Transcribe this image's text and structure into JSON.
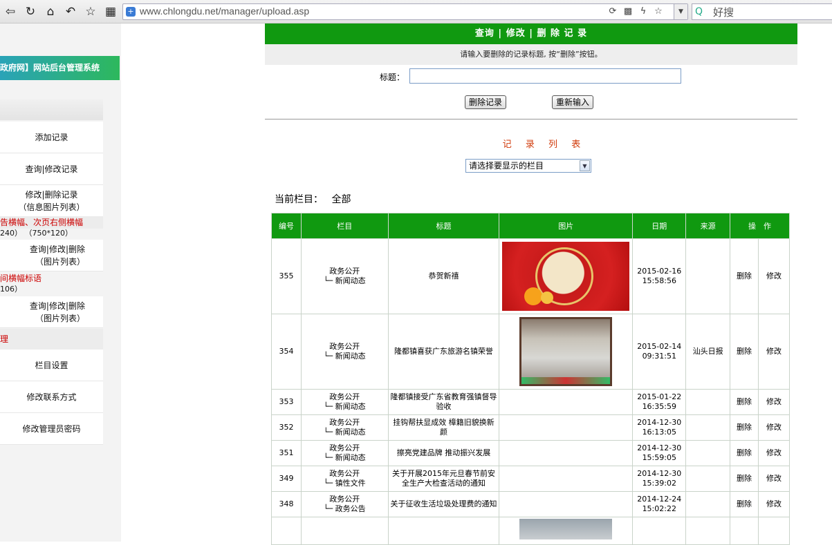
{
  "browser": {
    "url": "www.chlongdu.net/manager/upload.asp",
    "search_text": "好搜"
  },
  "sidebar": {
    "title": "政府网】网站后台管理系统",
    "items": [
      {
        "label": "添加记录"
      },
      {
        "label": "查询|修改记录"
      },
      {
        "label1": "修改|删除记录",
        "label2": "（信息图片列表）"
      },
      {
        "red": "告横幅、次页右侧横幅",
        "sizes": "240）   （750*120）"
      },
      {
        "label1": "查询|修改|删除",
        "label2": "（图片列表）"
      },
      {
        "red": "间横幅标语",
        "sizes": "106）"
      },
      {
        "label1": "查询|修改|删除",
        "label2": "（图片列表）"
      },
      {
        "red": "理"
      },
      {
        "label": "栏目设置"
      },
      {
        "label": "修改联系方式"
      },
      {
        "label": "修改管理员密码"
      }
    ]
  },
  "main": {
    "header": "查询 | 修改 | 删 除 记 录",
    "hint": "请输入要删除的记录标题, 按“删除”按钮。",
    "title_label": "标题：",
    "title_value": "",
    "delete_button": "删除记录",
    "reset_button": "重新输入",
    "list_title": "记 录 列 表",
    "select_value": "请选择要显示的栏目",
    "current_category_label": "当前栏目：",
    "current_category_value": "全部"
  },
  "table": {
    "headers": [
      "编号",
      "栏目",
      "标题",
      "图片",
      "日期",
      "来源",
      "操　作"
    ],
    "rows": [
      {
        "id": "355",
        "cat1": "政务公开",
        "cat2": "└─ 新闻动态",
        "title": "恭贺新禧",
        "image": "red",
        "date": "2015-02-16",
        "time": "15:58:56",
        "source": "",
        "delete": "删除",
        "edit": "修改"
      },
      {
        "id": "354",
        "cat1": "政务公开",
        "cat2": "└─ 新闻动态",
        "title": "隆都镇喜获广东旅游名镇荣誉",
        "image": "plaque",
        "date": "2015-02-14",
        "time": "09:31:51",
        "source": "汕头日报",
        "delete": "删除",
        "edit": "修改"
      },
      {
        "id": "353",
        "cat1": "政务公开",
        "cat2": "└─ 新闻动态",
        "title": "隆都镇接受广东省教育强镇督导验收",
        "image": "",
        "date": "2015-01-22",
        "time": "16:35:59",
        "source": "",
        "delete": "删除",
        "edit": "修改"
      },
      {
        "id": "352",
        "cat1": "政务公开",
        "cat2": "└─ 新闻动态",
        "title": "挂钩帮扶显成效  樟籍旧貌换新颜",
        "image": "",
        "date": "2014-12-30",
        "time": "16:13:05",
        "source": "",
        "delete": "删除",
        "edit": "修改"
      },
      {
        "id": "351",
        "cat1": "政务公开",
        "cat2": "└─ 新闻动态",
        "title": "擦亮党建品牌  推动振兴发展",
        "image": "",
        "date": "2014-12-30",
        "time": "15:59:05",
        "source": "",
        "delete": "删除",
        "edit": "修改"
      },
      {
        "id": "349",
        "cat1": "政务公开",
        "cat2": "└─ 镇性文件",
        "title": "关于开展2015年元旦春节前安全生产大检查活动的通知",
        "image": "",
        "date": "2014-12-30",
        "time": "15:39:02",
        "source": "",
        "delete": "删除",
        "edit": "修改"
      },
      {
        "id": "348",
        "cat1": "政务公开",
        "cat2": "└─ 政务公告",
        "title": "关于征收生活垃圾处理费的通知",
        "image": "",
        "date": "2014-12-24",
        "time": "15:02:22",
        "source": "",
        "delete": "删除",
        "edit": "修改"
      },
      {
        "id": "",
        "cat1": "",
        "cat2": "",
        "title": "",
        "image": "gray",
        "date": "",
        "time": "",
        "source": "",
        "delete": "",
        "edit": ""
      }
    ]
  }
}
